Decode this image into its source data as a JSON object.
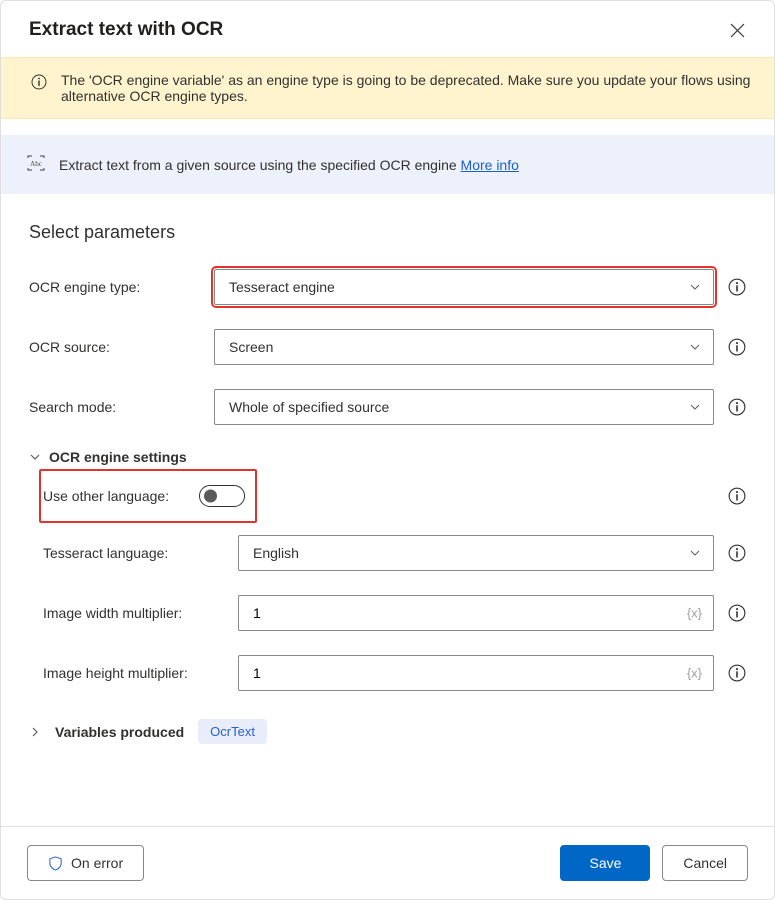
{
  "header": {
    "title": "Extract text with OCR"
  },
  "warning": {
    "text": "The 'OCR engine variable' as an engine type is going to be deprecated.  Make sure you update your flows using alternative OCR engine types."
  },
  "description": {
    "text": "Extract text from a given source using the specified OCR engine ",
    "link_label": "More info"
  },
  "section_title": "Select parameters",
  "fields": {
    "engine_type": {
      "label": "OCR engine type:",
      "value": "Tesseract engine"
    },
    "ocr_source": {
      "label": "OCR source:",
      "value": "Screen"
    },
    "search_mode": {
      "label": "Search mode:",
      "value": "Whole of specified source"
    }
  },
  "engine_settings": {
    "header": "OCR engine settings",
    "use_other_language": {
      "label": "Use other language:",
      "on": false
    },
    "tesseract_language": {
      "label": "Tesseract language:",
      "value": "English"
    },
    "width_multiplier": {
      "label": "Image width multiplier:",
      "value": "1"
    },
    "height_multiplier": {
      "label": "Image height multiplier:",
      "value": "1"
    }
  },
  "variables": {
    "header": "Variables produced",
    "badge": "OcrText"
  },
  "footer": {
    "on_error": "On error",
    "save": "Save",
    "cancel": "Cancel"
  }
}
